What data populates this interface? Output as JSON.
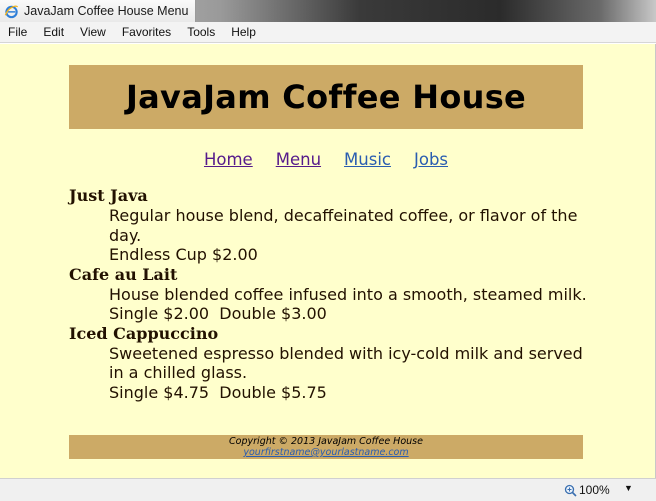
{
  "window": {
    "tab_title": "JavaJam Coffee House Menu"
  },
  "menubar": {
    "items": [
      "File",
      "Edit",
      "View",
      "Favorites",
      "Tools",
      "Help"
    ]
  },
  "page": {
    "heading": "JavaJam Coffee House",
    "nav": [
      "Home",
      "Menu",
      "Music",
      "Jobs"
    ],
    "menu_items": [
      {
        "name": "Just Java",
        "description": "Regular house blend, decaffeinated coffee, or flavor of the day.",
        "price": "Endless Cup $2.00"
      },
      {
        "name": "Cafe au Lait",
        "description": "House blended coffee infused into a smooth, steamed milk.",
        "price": "Single $2.00  Double $3.00"
      },
      {
        "name": "Iced Cappuccino",
        "description": "Sweetened espresso blended with icy-cold milk and served in a chilled glass.",
        "price": "Single $4.75  Double $5.75"
      }
    ],
    "footer": {
      "copyright": "Copyright © 2013 JavaJam Coffee House",
      "email": "yourfirstname@yourlastname.com"
    }
  },
  "statusbar": {
    "zoom": "100%"
  },
  "colors": {
    "page_background": "#ffffcc",
    "band": "#ccaa66",
    "visited_link": "#551a8b",
    "link": "#2a5db0"
  }
}
